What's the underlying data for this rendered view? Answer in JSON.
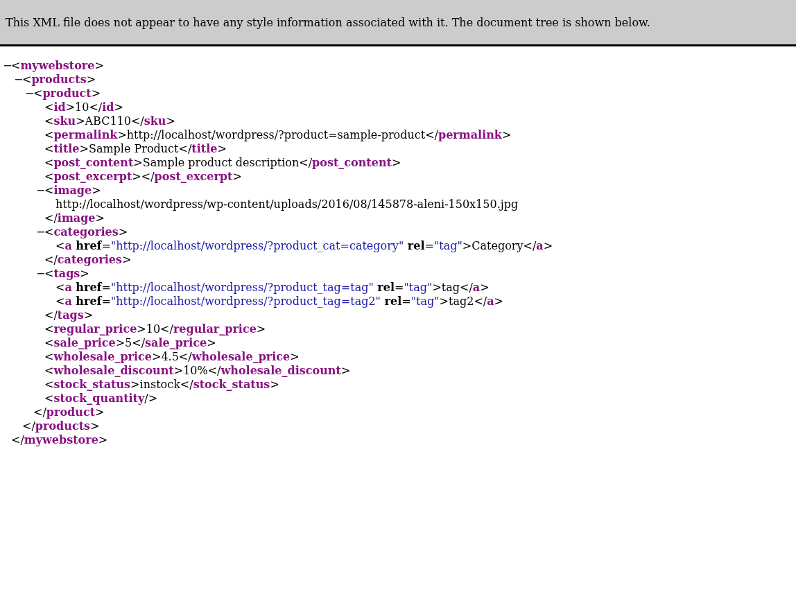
{
  "banner": "This XML file does not appear to have any style information associated with it. The document tree is shown below.",
  "tree": {
    "kind": "element",
    "expanded": true,
    "toggle": "−",
    "open": [
      {
        "kind": "plain",
        "text": "<"
      },
      {
        "kind": "tag",
        "text": "mywebstore"
      },
      {
        "kind": "plain",
        "text": ">"
      }
    ],
    "close": [
      {
        "kind": "plain",
        "text": "</"
      },
      {
        "kind": "tag",
        "text": "mywebstore"
      },
      {
        "kind": "plain",
        "text": ">"
      }
    ],
    "children": [
      {
        "kind": "element",
        "expanded": true,
        "toggle": "−",
        "open": [
          {
            "kind": "plain",
            "text": "<"
          },
          {
            "kind": "tag",
            "text": "products"
          },
          {
            "kind": "plain",
            "text": ">"
          }
        ],
        "close": [
          {
            "kind": "plain",
            "text": "</"
          },
          {
            "kind": "tag",
            "text": "products"
          },
          {
            "kind": "plain",
            "text": ">"
          }
        ],
        "children": [
          {
            "kind": "element",
            "expanded": true,
            "toggle": "−",
            "open": [
              {
                "kind": "plain",
                "text": "<"
              },
              {
                "kind": "tag",
                "text": "product"
              },
              {
                "kind": "plain",
                "text": ">"
              }
            ],
            "close": [
              {
                "kind": "plain",
                "text": "</"
              },
              {
                "kind": "tag",
                "text": "product"
              },
              {
                "kind": "plain",
                "text": ">"
              }
            ],
            "children": [
              {
                "kind": "line",
                "tokens": [
                  {
                    "kind": "plain",
                    "text": "<"
                  },
                  {
                    "kind": "tag",
                    "text": "id"
                  },
                  {
                    "kind": "plain",
                    "text": ">10</"
                  },
                  {
                    "kind": "tag",
                    "text": "id"
                  },
                  {
                    "kind": "plain",
                    "text": ">"
                  }
                ]
              },
              {
                "kind": "line",
                "tokens": [
                  {
                    "kind": "plain",
                    "text": "<"
                  },
                  {
                    "kind": "tag",
                    "text": "sku"
                  },
                  {
                    "kind": "plain",
                    "text": ">ABC110</"
                  },
                  {
                    "kind": "tag",
                    "text": "sku"
                  },
                  {
                    "kind": "plain",
                    "text": ">"
                  }
                ]
              },
              {
                "kind": "line",
                "tokens": [
                  {
                    "kind": "plain",
                    "text": "<"
                  },
                  {
                    "kind": "tag",
                    "text": "permalink"
                  },
                  {
                    "kind": "plain",
                    "text": ">http://localhost/wordpress/?product=sample-product</"
                  },
                  {
                    "kind": "tag",
                    "text": "permalink"
                  },
                  {
                    "kind": "plain",
                    "text": ">"
                  }
                ]
              },
              {
                "kind": "line",
                "tokens": [
                  {
                    "kind": "plain",
                    "text": "<"
                  },
                  {
                    "kind": "tag",
                    "text": "title"
                  },
                  {
                    "kind": "plain",
                    "text": ">Sample Product</"
                  },
                  {
                    "kind": "tag",
                    "text": "title"
                  },
                  {
                    "kind": "plain",
                    "text": ">"
                  }
                ]
              },
              {
                "kind": "line",
                "tokens": [
                  {
                    "kind": "plain",
                    "text": "<"
                  },
                  {
                    "kind": "tag",
                    "text": "post_content"
                  },
                  {
                    "kind": "plain",
                    "text": ">Sample product description</"
                  },
                  {
                    "kind": "tag",
                    "text": "post_content"
                  },
                  {
                    "kind": "plain",
                    "text": ">"
                  }
                ]
              },
              {
                "kind": "line",
                "tokens": [
                  {
                    "kind": "plain",
                    "text": "<"
                  },
                  {
                    "kind": "tag",
                    "text": "post_excerpt"
                  },
                  {
                    "kind": "plain",
                    "text": "></"
                  },
                  {
                    "kind": "tag",
                    "text": "post_excerpt"
                  },
                  {
                    "kind": "plain",
                    "text": ">"
                  }
                ]
              },
              {
                "kind": "element",
                "expanded": true,
                "toggle": "−",
                "open": [
                  {
                    "kind": "plain",
                    "text": "<"
                  },
                  {
                    "kind": "tag",
                    "text": "image"
                  },
                  {
                    "kind": "plain",
                    "text": ">"
                  }
                ],
                "close": [
                  {
                    "kind": "plain",
                    "text": "</"
                  },
                  {
                    "kind": "tag",
                    "text": "image"
                  },
                  {
                    "kind": "plain",
                    "text": ">"
                  }
                ],
                "children": [
                  {
                    "kind": "line",
                    "tokens": [
                      {
                        "kind": "plain",
                        "text": "http://localhost/wordpress/wp-content/uploads/2016/08/145878-aleni-150x150.jpg"
                      }
                    ]
                  }
                ]
              },
              {
                "kind": "element",
                "expanded": true,
                "toggle": "−",
                "open": [
                  {
                    "kind": "plain",
                    "text": "<"
                  },
                  {
                    "kind": "tag",
                    "text": "categories"
                  },
                  {
                    "kind": "plain",
                    "text": ">"
                  }
                ],
                "close": [
                  {
                    "kind": "plain",
                    "text": "</"
                  },
                  {
                    "kind": "tag",
                    "text": "categories"
                  },
                  {
                    "kind": "plain",
                    "text": ">"
                  }
                ],
                "children": [
                  {
                    "kind": "line",
                    "tokens": [
                      {
                        "kind": "plain",
                        "text": "<"
                      },
                      {
                        "kind": "tag",
                        "text": "a"
                      },
                      {
                        "kind": "attr",
                        "text": " href"
                      },
                      {
                        "kind": "plain",
                        "text": "="
                      },
                      {
                        "kind": "value",
                        "text": "\"http://localhost/wordpress/?product_cat=category\""
                      },
                      {
                        "kind": "attr",
                        "text": " rel"
                      },
                      {
                        "kind": "plain",
                        "text": "="
                      },
                      {
                        "kind": "value",
                        "text": "\"tag\""
                      },
                      {
                        "kind": "plain",
                        "text": ">Category</"
                      },
                      {
                        "kind": "tag",
                        "text": "a"
                      },
                      {
                        "kind": "plain",
                        "text": ">"
                      }
                    ]
                  }
                ]
              },
              {
                "kind": "element",
                "expanded": true,
                "toggle": "−",
                "open": [
                  {
                    "kind": "plain",
                    "text": "<"
                  },
                  {
                    "kind": "tag",
                    "text": "tags"
                  },
                  {
                    "kind": "plain",
                    "text": ">"
                  }
                ],
                "close": [
                  {
                    "kind": "plain",
                    "text": "</"
                  },
                  {
                    "kind": "tag",
                    "text": "tags"
                  },
                  {
                    "kind": "plain",
                    "text": ">"
                  }
                ],
                "children": [
                  {
                    "kind": "line",
                    "tokens": [
                      {
                        "kind": "plain",
                        "text": "<"
                      },
                      {
                        "kind": "tag",
                        "text": "a"
                      },
                      {
                        "kind": "attr",
                        "text": " href"
                      },
                      {
                        "kind": "plain",
                        "text": "="
                      },
                      {
                        "kind": "value",
                        "text": "\"http://localhost/wordpress/?product_tag=tag\""
                      },
                      {
                        "kind": "attr",
                        "text": " rel"
                      },
                      {
                        "kind": "plain",
                        "text": "="
                      },
                      {
                        "kind": "value",
                        "text": "\"tag\""
                      },
                      {
                        "kind": "plain",
                        "text": ">tag</"
                      },
                      {
                        "kind": "tag",
                        "text": "a"
                      },
                      {
                        "kind": "plain",
                        "text": ">"
                      }
                    ]
                  },
                  {
                    "kind": "line",
                    "tokens": [
                      {
                        "kind": "plain",
                        "text": "<"
                      },
                      {
                        "kind": "tag",
                        "text": "a"
                      },
                      {
                        "kind": "attr",
                        "text": " href"
                      },
                      {
                        "kind": "plain",
                        "text": "="
                      },
                      {
                        "kind": "value",
                        "text": "\"http://localhost/wordpress/?product_tag=tag2\""
                      },
                      {
                        "kind": "attr",
                        "text": " rel"
                      },
                      {
                        "kind": "plain",
                        "text": "="
                      },
                      {
                        "kind": "value",
                        "text": "\"tag\""
                      },
                      {
                        "kind": "plain",
                        "text": ">tag2</"
                      },
                      {
                        "kind": "tag",
                        "text": "a"
                      },
                      {
                        "kind": "plain",
                        "text": ">"
                      }
                    ]
                  }
                ]
              },
              {
                "kind": "line",
                "tokens": [
                  {
                    "kind": "plain",
                    "text": "<"
                  },
                  {
                    "kind": "tag",
                    "text": "regular_price"
                  },
                  {
                    "kind": "plain",
                    "text": ">10</"
                  },
                  {
                    "kind": "tag",
                    "text": "regular_price"
                  },
                  {
                    "kind": "plain",
                    "text": ">"
                  }
                ]
              },
              {
                "kind": "line",
                "tokens": [
                  {
                    "kind": "plain",
                    "text": "<"
                  },
                  {
                    "kind": "tag",
                    "text": "sale_price"
                  },
                  {
                    "kind": "plain",
                    "text": ">5</"
                  },
                  {
                    "kind": "tag",
                    "text": "sale_price"
                  },
                  {
                    "kind": "plain",
                    "text": ">"
                  }
                ]
              },
              {
                "kind": "line",
                "tokens": [
                  {
                    "kind": "plain",
                    "text": "<"
                  },
                  {
                    "kind": "tag",
                    "text": "wholesale_price"
                  },
                  {
                    "kind": "plain",
                    "text": ">4.5</"
                  },
                  {
                    "kind": "tag",
                    "text": "wholesale_price"
                  },
                  {
                    "kind": "plain",
                    "text": ">"
                  }
                ]
              },
              {
                "kind": "line",
                "tokens": [
                  {
                    "kind": "plain",
                    "text": "<"
                  },
                  {
                    "kind": "tag",
                    "text": "wholesale_discount"
                  },
                  {
                    "kind": "plain",
                    "text": ">10%</"
                  },
                  {
                    "kind": "tag",
                    "text": "wholesale_discount"
                  },
                  {
                    "kind": "plain",
                    "text": ">"
                  }
                ]
              },
              {
                "kind": "line",
                "tokens": [
                  {
                    "kind": "plain",
                    "text": "<"
                  },
                  {
                    "kind": "tag",
                    "text": "stock_status"
                  },
                  {
                    "kind": "plain",
                    "text": ">instock</"
                  },
                  {
                    "kind": "tag",
                    "text": "stock_status"
                  },
                  {
                    "kind": "plain",
                    "text": ">"
                  }
                ]
              },
              {
                "kind": "line",
                "tokens": [
                  {
                    "kind": "plain",
                    "text": "<"
                  },
                  {
                    "kind": "tag",
                    "text": "stock_quantity"
                  },
                  {
                    "kind": "plain",
                    "text": "/>"
                  }
                ]
              }
            ]
          }
        ]
      }
    ]
  }
}
